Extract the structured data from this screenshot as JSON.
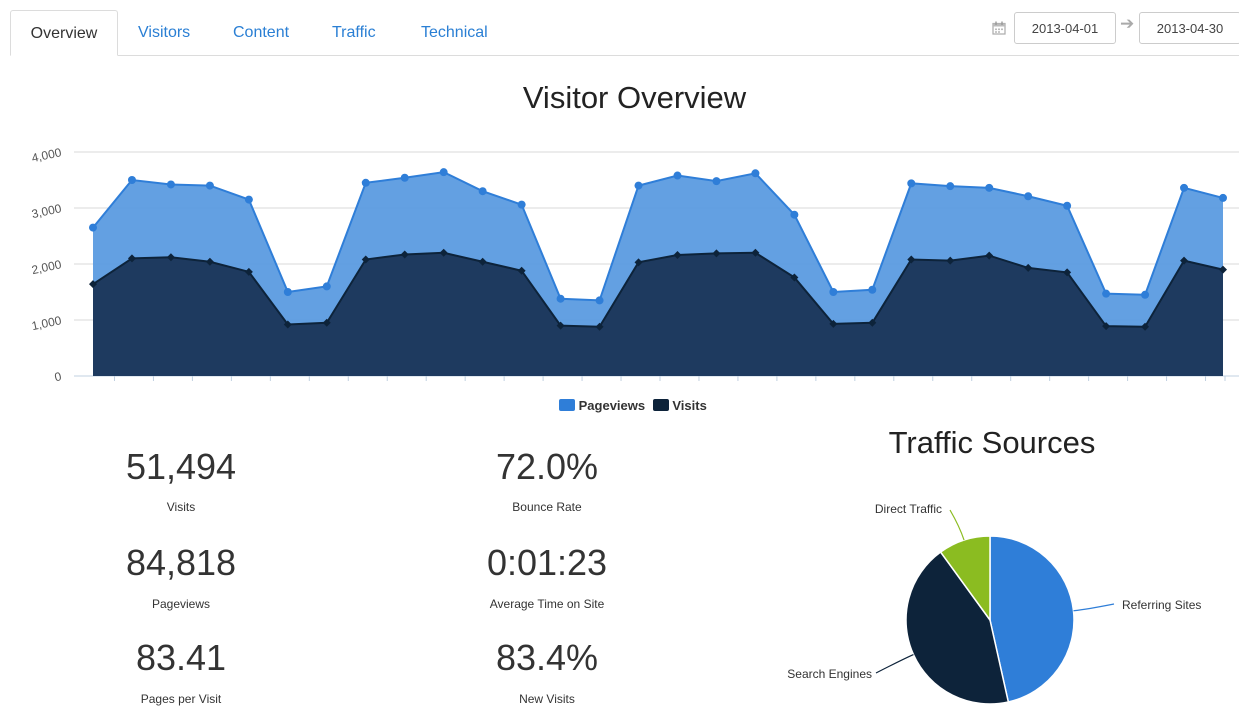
{
  "tabs": [
    {
      "label": "Overview",
      "active": true
    },
    {
      "label": "Visitors",
      "active": false
    },
    {
      "label": "Content",
      "active": false
    },
    {
      "label": "Traffic",
      "active": false
    },
    {
      "label": "Technical",
      "active": false
    }
  ],
  "date_range": {
    "start": "2013-04-01",
    "end": "2013-04-30",
    "icon": "calendar-icon",
    "separator_icon": "arrow-right-icon"
  },
  "colors": {
    "pageviews": "#5b9be0",
    "pageviews_line": "#2f7ed8",
    "visits": "#1e3a5f",
    "visits_line": "#0d233a",
    "direct": "#8bbc21",
    "search": "#0d233a",
    "referring": "#2f7ed8",
    "tab_link": "#2a7fd4"
  },
  "stats": [
    {
      "value": "51,494",
      "label": "Visits"
    },
    {
      "value": "72.0%",
      "label": "Bounce Rate"
    },
    {
      "value": "84,818",
      "label": "Pageviews"
    },
    {
      "value": "0:01:23",
      "label": "Average Time on Site"
    },
    {
      "value": "83.41",
      "label": "Pages per Visit"
    },
    {
      "value": "83.4%",
      "label": "New Visits"
    }
  ],
  "chart_data": [
    {
      "type": "area",
      "title": "Visitor Overview",
      "xlabel": "",
      "ylabel": "",
      "ylim": [
        0,
        4000
      ],
      "yticks": [
        0,
        1000,
        2000,
        3000,
        4000
      ],
      "ytick_labels": [
        "0",
        "1,000",
        "2,000",
        "3,000",
        "4,000"
      ],
      "grid": true,
      "legend": "bottom-center",
      "x": [
        1,
        2,
        3,
        4,
        5,
        6,
        7,
        8,
        9,
        10,
        11,
        12,
        13,
        14,
        15,
        16,
        17,
        18,
        19,
        20,
        21,
        22,
        23,
        24,
        25,
        26,
        27,
        28,
        29,
        30
      ],
      "series": [
        {
          "name": "Pageviews",
          "values": [
            2650,
            3500,
            3420,
            3400,
            3150,
            1500,
            1600,
            3450,
            3540,
            3640,
            3300,
            3060,
            1380,
            1350,
            3400,
            3580,
            3480,
            3620,
            2880,
            1500,
            1540,
            3440,
            3390,
            3360,
            3210,
            3040,
            1470,
            1450,
            3360,
            3180
          ]
        },
        {
          "name": "Visits",
          "values": [
            1640,
            2100,
            2120,
            2040,
            1860,
            920,
            950,
            2080,
            2170,
            2200,
            2040,
            1880,
            900,
            880,
            2030,
            2160,
            2190,
            2200,
            1760,
            930,
            950,
            2080,
            2060,
            2150,
            1930,
            1850,
            890,
            880,
            2060,
            1900
          ]
        }
      ]
    },
    {
      "type": "pie",
      "title": "Traffic Sources",
      "slices": [
        {
          "label": "Referring Sites",
          "value": 46.5
        },
        {
          "label": "Search Engines",
          "value": 43.5
        },
        {
          "label": "Direct Traffic",
          "value": 10.0
        }
      ]
    }
  ]
}
